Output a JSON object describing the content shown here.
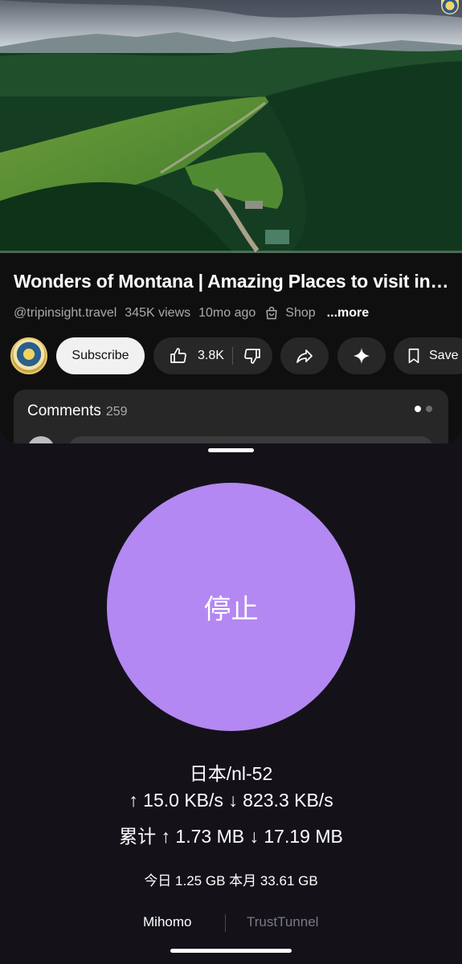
{
  "video": {
    "title": "Wonders of Montana | Amazing Places to visit in Montana",
    "channel_handle": "@tripinsight.travel",
    "views": "345K views",
    "age": "10mo ago",
    "shop_label": "Shop",
    "more_label": "...more",
    "progress_fraction": 0.0
  },
  "actions": {
    "subscribe_label": "Subscribe",
    "likes": "3.8K",
    "save_label": "Save",
    "share_icon": "share-icon",
    "ai_icon": "sparkle-icon"
  },
  "comments": {
    "label": "Comments",
    "count": "259"
  },
  "vpn": {
    "button_label": "停止",
    "node": "日本/nl-52",
    "speed": "↑ 15.0 KB/s ↓ 823.3 KB/s",
    "total": "累计 ↑ 1.73 MB ↓ 17.19 MB",
    "usage": "今日 1.25 GB 本月 33.61 GB",
    "tabs": [
      {
        "label": "Mihomo",
        "active": true
      },
      {
        "label": "TrustTunnel",
        "active": false
      }
    ],
    "accent": "#b388f2",
    "background": "#141218"
  }
}
